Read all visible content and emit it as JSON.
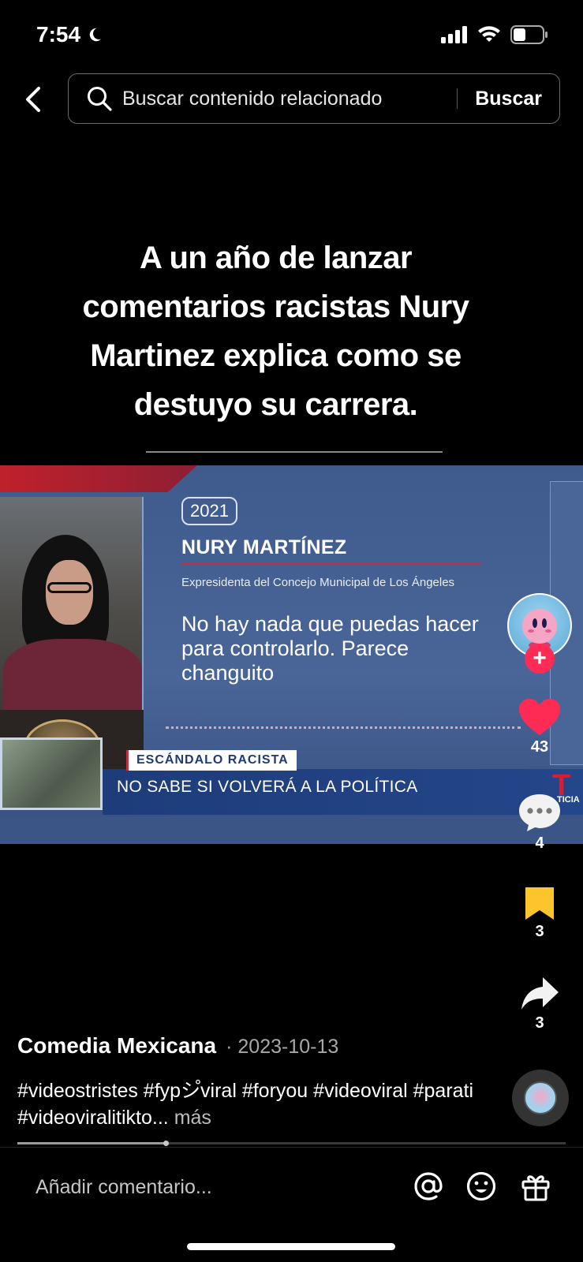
{
  "status_bar": {
    "time": "7:54",
    "icons": [
      "moon-icon",
      "cellular-signal-icon",
      "wifi-icon",
      "battery-icon"
    ]
  },
  "search": {
    "placeholder": "Buscar contenido relacionado",
    "button_label": "Buscar"
  },
  "caption": {
    "text": "A un año de lanzar comentarios racistas Nury Martinez explica como se destuyo su carrera."
  },
  "video": {
    "year_badge": "2021",
    "name": "NURY MARTÍNEZ",
    "role": "Expresidenta del Concejo Municipal de Los Ángeles",
    "quote": "No hay nada que puedas hacer para controlarlo. Parece changuito",
    "tag": "ESCÁNDALO RACISTA",
    "lower_third": "NO SABE SI VOLVERÁ A LA POLÍTICA",
    "logo_letter": "T",
    "logo_sub": "TICIA"
  },
  "actions": {
    "likes": "43",
    "comments": "4",
    "bookmarks": "3",
    "shares": "3",
    "follow_symbol": "+"
  },
  "post": {
    "author": "Comedia Mexicana",
    "date": "· 2023-10-13",
    "hashtags": "#videostristes  #fypシ゚viral #foryou #videoviral #parati #videoviralitikto...",
    "more": " más",
    "progress": 0.27
  },
  "comment_bar": {
    "placeholder": "Añadir comentario..."
  },
  "colors": {
    "like": "#fe2c55",
    "bookmark": "#fcc52c",
    "accent": "#fe2c55"
  }
}
